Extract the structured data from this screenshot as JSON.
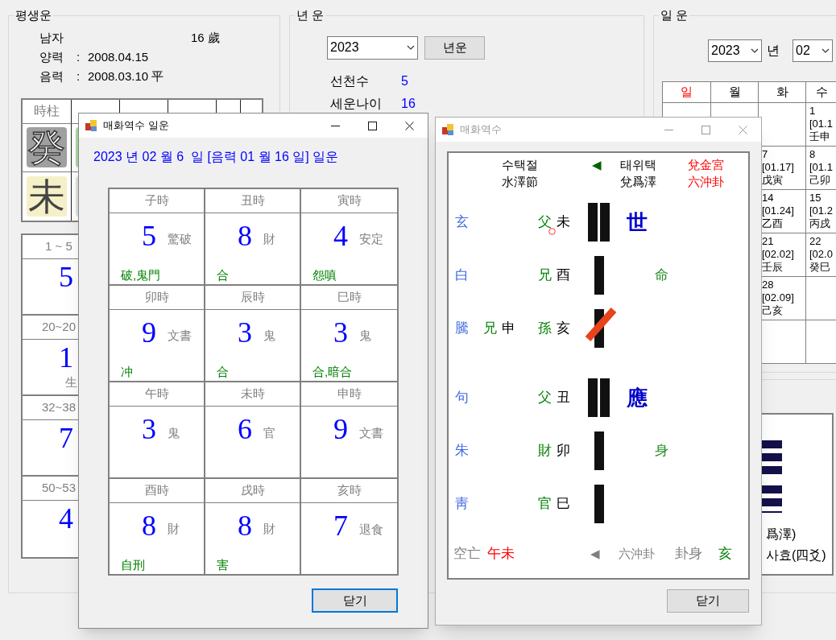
{
  "main": {
    "lifetime": {
      "title": "평생운",
      "gender": "남자",
      "age": "16 歲",
      "dates": [
        {
          "label": "양력",
          "colon": ":",
          "value": "2008.04.15"
        },
        {
          "label": "음력",
          "colon": ":",
          "value": "2008.03.10 平"
        }
      ],
      "pillars": [
        {
          "header": "時柱",
          "stem": {
            "char": "癸",
            "color": "#a0a0a0"
          },
          "branch": {
            "char": "未",
            "color": "#f5f0c8"
          }
        },
        {
          "stem": {
            "color": "#a8d8a0"
          },
          "branch": {
            "color": "#e0e0e0"
          }
        }
      ],
      "periods": [
        {
          "range": "1 ~ 5",
          "number": "5"
        },
        {
          "range": "20~20",
          "number": "1",
          "word": "生"
        },
        {
          "range": "32~38",
          "number": "7"
        },
        {
          "range": "50~53",
          "number": "4"
        }
      ]
    },
    "year_fortune": {
      "title": "년 운",
      "year": "2023",
      "button": "년운",
      "rows": [
        {
          "label": "선천수",
          "value": "5"
        },
        {
          "label": "세운나이",
          "value": "16"
        }
      ]
    },
    "day_fortune": {
      "title": "일 운",
      "year": "2023",
      "year_unit": "년",
      "month": "02",
      "weekdays": [
        {
          "label": "일",
          "sunday": true
        },
        {
          "label": "월",
          "sunday": false
        },
        {
          "label": "화",
          "sunday": false
        },
        {
          "label": "수",
          "sunday": false
        }
      ],
      "weeks": [
        [
          {
            "kind": "wednesday",
            "day": "1",
            "lunar": "[01.1",
            "ganji": "壬申"
          }
        ],
        [
          {
            "kind": "tuesday",
            "day": "7",
            "lunar": "[01.17]",
            "ganji": "戊寅"
          },
          {
            "kind": "wednesday",
            "day": "8",
            "lunar": "[01.1",
            "ganji": "己卯"
          }
        ],
        [
          {
            "kind": "tuesday",
            "day": "14",
            "lunar": "[01.24]",
            "ganji": "乙酉"
          },
          {
            "kind": "wednesday",
            "day": "15",
            "lunar": "[01.2",
            "ganji": "丙戌"
          }
        ],
        [
          {
            "kind": "tuesday",
            "day": "21",
            "lunar": "[02.02]",
            "ganji": "壬辰"
          },
          {
            "kind": "wednesday",
            "day": "22",
            "lunar": "[02.0",
            "ganji": "癸巳"
          }
        ],
        [
          {
            "kind": "tuesday",
            "day": "28",
            "lunar": "[02.09]",
            "ganji": "己亥"
          }
        ]
      ],
      "hexagram_notes": [
        "爲澤)",
        "사효(四爻)"
      ]
    }
  },
  "daily_window": {
    "title": "매화역수 일운",
    "active": true,
    "heading": "2023 년 02 월 6  일 [음력 01 월 16 일] 일운",
    "hours": [
      {
        "name": "子時",
        "number": "5",
        "word": "驚破",
        "note": "破,鬼門"
      },
      {
        "name": "丑時",
        "number": "8",
        "word": "財",
        "note": "合"
      },
      {
        "name": "寅時",
        "number": "4",
        "word": "安定",
        "note": "怨嗔"
      },
      {
        "name": "卯時",
        "number": "9",
        "word": "文書",
        "note": "冲"
      },
      {
        "name": "辰時",
        "number": "3",
        "word": "鬼",
        "note": "合"
      },
      {
        "name": "巳時",
        "number": "3",
        "word": "鬼",
        "note": "合,暗合"
      },
      {
        "name": "午時",
        "number": "3",
        "word": "鬼"
      },
      {
        "name": "未時",
        "number": "6",
        "word": "官"
      },
      {
        "name": "申時",
        "number": "9",
        "word": "文書"
      },
      {
        "name": "酉時",
        "number": "8",
        "word": "財",
        "note": "自刑"
      },
      {
        "name": "戌時",
        "number": "8",
        "word": "財",
        "note": "害"
      },
      {
        "name": "亥時",
        "number": "7",
        "word": "退食"
      }
    ],
    "button": "닫기"
  },
  "hexagram_window": {
    "title": "매화역수",
    "active": false,
    "header": {
      "from_hangul": "수택절",
      "from_hanja": "水澤節",
      "arrow": "◀",
      "to_hangul": "태위택",
      "to_hanja": "兌爲澤",
      "palace": "兌金宮",
      "type": "六沖卦"
    },
    "lines": [
      {
        "spirit": "玄",
        "relation": "父",
        "branch": "未",
        "kind": "yin",
        "moving": false,
        "circled": true,
        "seat": "世"
      },
      {
        "spirit": "白",
        "relation": "兄",
        "branch": "酉",
        "kind": "yang",
        "moving": false,
        "circled": false,
        "mark": "命"
      },
      {
        "spirit": "騰",
        "hidden_relation": "兄",
        "hidden_branch": "申",
        "relation": "孫",
        "branch": "亥",
        "kind": "yang",
        "moving": true,
        "circled": false
      },
      {
        "spirit": "句",
        "relation": "父",
        "branch": "丑",
        "kind": "yin",
        "moving": false,
        "circled": false,
        "seat": "應"
      },
      {
        "spirit": "朱",
        "relation": "財",
        "branch": "卯",
        "kind": "yang",
        "moving": false,
        "circled": false,
        "mark": "身"
      },
      {
        "spirit": "靑",
        "relation": "官",
        "branch": "巳",
        "kind": "yang",
        "moving": false,
        "circled": false
      }
    ],
    "footer": {
      "void_label": "空亡",
      "void": "午未",
      "arrow": "◀",
      "type": "六沖卦",
      "body_label": "卦身",
      "body": "亥"
    },
    "button": "닫기"
  }
}
